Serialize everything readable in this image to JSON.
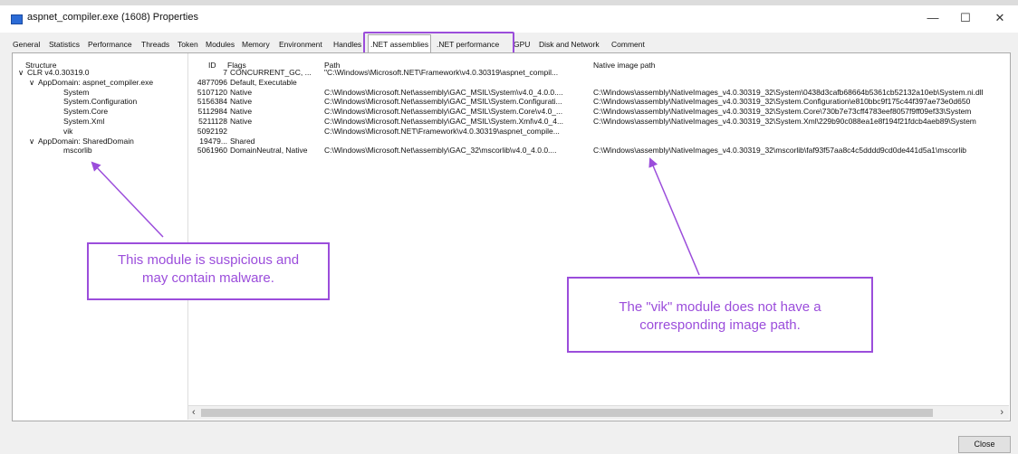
{
  "window": {
    "title": "aspnet_compiler.exe (1608) Properties",
    "minimize_glyph": "—",
    "maximize_glyph": "☐",
    "close_glyph": "✕"
  },
  "tabs": [
    {
      "label": "General"
    },
    {
      "label": "Statistics"
    },
    {
      "label": "Performance"
    },
    {
      "label": "Threads"
    },
    {
      "label": "Token"
    },
    {
      "label": "Modules"
    },
    {
      "label": "Memory"
    },
    {
      "label": "Environment"
    },
    {
      "label": "Handles"
    },
    {
      "label": ".NET assemblies"
    },
    {
      "label": ".NET performance"
    },
    {
      "label": "GPU"
    },
    {
      "label": "Disk and Network"
    },
    {
      "label": "Comment"
    }
  ],
  "columns": {
    "structure": "Structure",
    "id": "ID",
    "flags": "Flags",
    "path": "Path",
    "native_image_path": "Native image path"
  },
  "rows": [
    {
      "expander": "∨",
      "structure": "CLR v4.0.30319.0",
      "id": "7",
      "flags": "CONCURRENT_GC, ...",
      "path": "\"C:\\Windows\\Microsoft.NET\\Framework\\v4.0.30319\\aspnet_compil...",
      "native": ""
    },
    {
      "expander": "∨",
      "structure": "AppDomain: aspnet_compiler.exe",
      "id": "4877096",
      "flags": "Default, Executable",
      "path": "",
      "native": ""
    },
    {
      "expander": "",
      "structure": "System",
      "id": "5107120",
      "flags": "Native",
      "path": "C:\\Windows\\Microsoft.Net\\assembly\\GAC_MSIL\\System\\v4.0_4.0.0....",
      "native": "C:\\Windows\\assembly\\NativeImages_v4.0.30319_32\\System\\0438d3cafb68664b5361cb52132a10eb\\System.ni.dll"
    },
    {
      "expander": "",
      "structure": "System.Configuration",
      "id": "5156384",
      "flags": "Native",
      "path": "C:\\Windows\\Microsoft.Net\\assembly\\GAC_MSIL\\System.Configurati...",
      "native": "C:\\Windows\\assembly\\NativeImages_v4.0.30319_32\\System.Configuration\\e810bbc9f175c44f397ae73e0d650"
    },
    {
      "expander": "",
      "structure": "System.Core",
      "id": "5112984",
      "flags": "Native",
      "path": "C:\\Windows\\Microsoft.Net\\assembly\\GAC_MSIL\\System.Core\\v4.0_...",
      "native": "C:\\Windows\\assembly\\NativeImages_v4.0.30319_32\\System.Core\\730b7e73cff4783eef8057f9ff09ef33\\System"
    },
    {
      "expander": "",
      "structure": "System.Xml",
      "id": "5211128",
      "flags": "Native",
      "path": "C:\\Windows\\Microsoft.Net\\assembly\\GAC_MSIL\\System.Xml\\v4.0_4...",
      "native": "C:\\Windows\\assembly\\NativeImages_v4.0.30319_32\\System.Xml\\229b90c088ea1e8f194f21fdcb4aeb89\\System"
    },
    {
      "expander": "",
      "structure": "vik",
      "id": "5092192",
      "flags": "",
      "path": "C:\\Windows\\Microsoft.NET\\Framework\\v4.0.30319\\aspnet_compile...",
      "native": ""
    },
    {
      "expander": "∨",
      "structure": "AppDomain: SharedDomain",
      "id": "19479...",
      "flags": "Shared",
      "path": "",
      "native": ""
    },
    {
      "expander": "",
      "structure": "mscorlib",
      "id": "5061960",
      "flags": "DomainNeutral, Native",
      "path": "C:\\Windows\\Microsoft.Net\\assembly\\GAC_32\\mscorlib\\v4.0_4.0.0....",
      "native": "C:\\Windows\\assembly\\NativeImages_v4.0.30319_32\\mscorlib\\faf93f57aa8c4c5dddd9cd0de441d5a1\\mscorlib"
    }
  ],
  "scroll": {
    "left_glyph": "‹",
    "right_glyph": "›"
  },
  "callouts": {
    "left_line1": "This module is suspicious and",
    "left_line2": "may contain malware.",
    "right_line1": "The \"vik\" module does not have a",
    "right_line2": "corresponding image path."
  },
  "buttons": {
    "close": "Close"
  },
  "colors": {
    "highlight": "#9b4ddb",
    "app_icon": "#2b6bd6"
  }
}
